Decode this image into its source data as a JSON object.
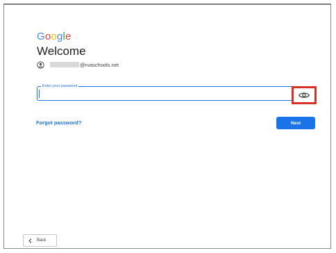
{
  "logo": {
    "text": "Google",
    "letters": [
      "G",
      "o",
      "o",
      "g",
      "l",
      "e"
    ]
  },
  "welcome": {
    "title": "Welcome"
  },
  "account": {
    "email_suffix": "@rvaschools.net",
    "icon": "account-circle-icon"
  },
  "password": {
    "label": "Enter your password",
    "value": "",
    "toggle_icon": "eye-icon"
  },
  "actions": {
    "forgot_label": "Forgot password?",
    "next_label": "Next",
    "back_label": "Back"
  },
  "colors": {
    "accent": "#1a73e8",
    "highlight": "#d93025"
  }
}
